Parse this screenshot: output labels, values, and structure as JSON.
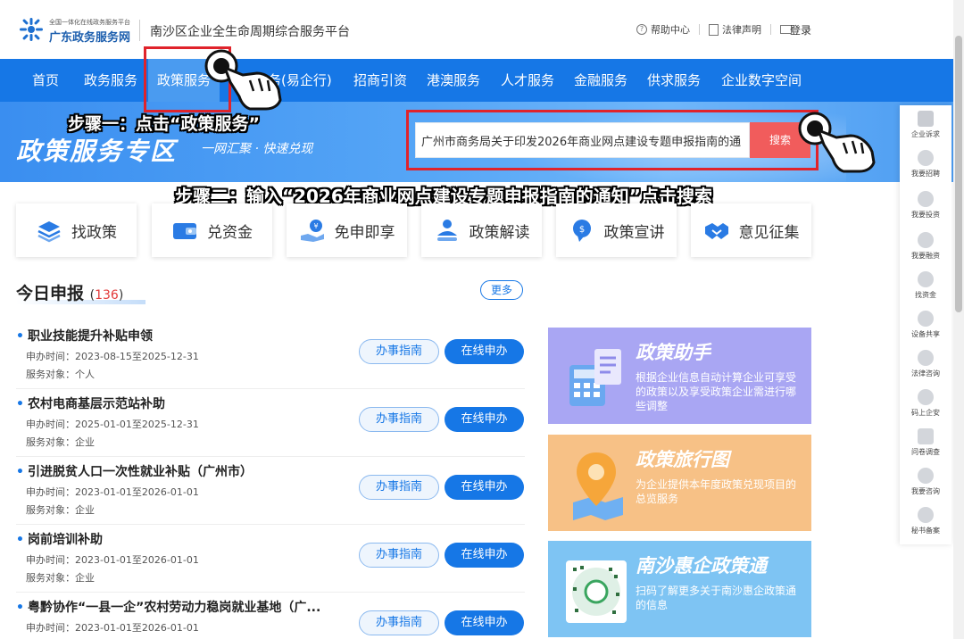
{
  "header": {
    "logo_small": "全国一体化在线政务服务平台",
    "logo_main": "广东政务服务网",
    "platform_title": "南沙区企业全生命周期综合服务平台",
    "help": "帮助中心",
    "legal": "法律声明",
    "login": "登录"
  },
  "nav": {
    "items": [
      "首页",
      "政务服务",
      "政策服务",
      "务(易企行)",
      "招商引资",
      "港澳服务",
      "人才服务",
      "金融服务",
      "供求服务",
      "企业数字空间"
    ],
    "active": "政策服务"
  },
  "banner": {
    "title": "政策服务专区",
    "subtitle": "一网汇聚 · 快速兑现",
    "search_value": "广州市商务局关于印发2026年商业网点建设专题申报指南的通",
    "search_button": "搜索"
  },
  "annotations": {
    "step1": "步骤一：点击“政策服务”",
    "step2": "步骤二：输入“2026年商业网点建设专题申报指南的通知”点击搜索",
    "highlight_color": "#e0232b"
  },
  "quick_entries": [
    {
      "label": "找政策",
      "icon": "stack-icon"
    },
    {
      "label": "兑资金",
      "icon": "wallet-icon"
    },
    {
      "label": "免申即享",
      "icon": "hand-coin-icon"
    },
    {
      "label": "政策解读",
      "icon": "megaphone-person-icon"
    },
    {
      "label": "政策宣讲",
      "icon": "speech-badge-icon"
    },
    {
      "label": "意见征集",
      "icon": "handshake-icon"
    }
  ],
  "today": {
    "title": "今日申报",
    "count": "136",
    "more": "更多",
    "guide_label": "办事指南",
    "online_label": "在线申办",
    "items": [
      {
        "title": "职业技能提升补贴申领",
        "time": "申办时间：2023-08-15至2025-12-31",
        "target": "服务对象：个人"
      },
      {
        "title": "农村电商基层示范站补助",
        "time": "申办时间：2025-01-01至2025-12-31",
        "target": "服务对象：企业"
      },
      {
        "title": "引进脱贫人口一次性就业补贴（广州市）",
        "time": "申办时间：2023-01-01至2026-01-01",
        "target": "服务对象：企业"
      },
      {
        "title": "岗前培训补助",
        "time": "申办时间：2023-01-01至2026-01-01",
        "target": "服务对象：企业"
      },
      {
        "title": "粤黔协作“一县一企”农村劳动力稳岗就业基地（广...",
        "time": "申办时间：2023-01-01至2026-01-01",
        "target": ""
      }
    ]
  },
  "cards": [
    {
      "title": "政策助手",
      "desc": "根据企业信息自动计算企业可享受的政策以及享受政策企业需进行哪些调整",
      "color": "#a9a6f3"
    },
    {
      "title": "政策旅行图",
      "desc": "为企业提供本年度政策兑现项目的总览服务",
      "color": "#f7c186"
    },
    {
      "title": "南沙惠企政策通",
      "desc": "扫码了解更多关于南沙惠企政策通的信息",
      "color": "#7ec4f3"
    }
  ],
  "float_bar": {
    "items": [
      "企业诉求",
      "我要招聘",
      "我要投资",
      "我要融资",
      "找资金",
      "设备共享",
      "法律咨询",
      "码上企安",
      "问卷调查",
      "我要咨询",
      "秘书备案"
    ]
  }
}
